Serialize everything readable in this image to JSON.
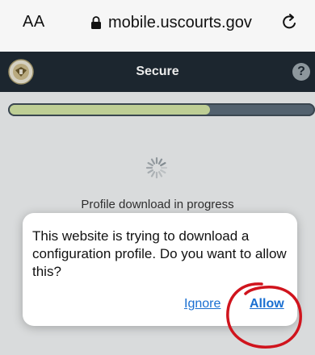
{
  "browser": {
    "text_size_label": "AA",
    "url": "mobile.uscourts.gov"
  },
  "header": {
    "title": "Secure",
    "help_label": "?"
  },
  "content": {
    "progress_fraction": 0.66,
    "progress_label": "Profile download in progress"
  },
  "dialog": {
    "message": "This website is trying to download a configuration profile. Do you want to allow this?",
    "ignore_label": "Ignore",
    "allow_label": "Allow"
  },
  "colors": {
    "header_bg": "#1f2a33",
    "progress_fill": "#cfe0a2",
    "link": "#1a6fd1",
    "annotation": "#d0141d"
  }
}
